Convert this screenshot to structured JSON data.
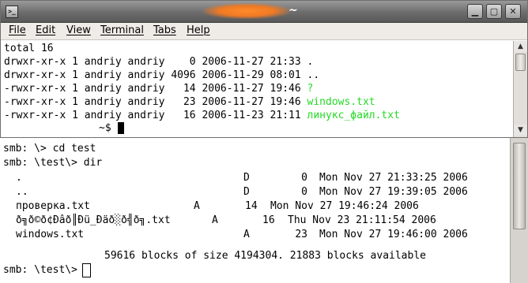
{
  "window": {
    "title": "~",
    "icon_glyph": ">_",
    "buttons": {
      "minimize": "▁",
      "maximize": "▢",
      "close": "✕"
    }
  },
  "menu": [
    "File",
    "Edit",
    "View",
    "Terminal",
    "Tabs",
    "Help"
  ],
  "listing": {
    "total": "total 16",
    "rows": [
      {
        "meta": "drwxr-xr-x 1 andriy andriy    0 2006-11-27 21:33 ",
        "name": "."
      },
      {
        "meta": "drwxr-xr-x 1 andriy andriy 4096 2006-11-29 08:01 ",
        "name": ".."
      },
      {
        "meta": "-rwxr-xr-x 1 andriy andriy   14 2006-11-27 19:46 ",
        "name": "?"
      },
      {
        "meta": "-rwxr-xr-x 1 andriy andriy   23 2006-11-27 19:46 ",
        "name": "windows.txt"
      },
      {
        "meta": "-rwxr-xr-x 1 andriy andriy   16 2006-11-23 21:11 ",
        "name": "линукс_файл.txt"
      }
    ],
    "prompt": "~$ "
  },
  "smb": {
    "cmd1": "smb: \\> cd test",
    "cmd2": "smb: \\test\\> dir",
    "entries": [
      {
        "name": ".",
        "attr": "D",
        "size": "0",
        "date": "Mon Nov 27 21:33:25 2006"
      },
      {
        "name": "..",
        "attr": "D",
        "size": "0",
        "date": "Mon Nov 27 19:39:05 2006"
      },
      {
        "name": "проверка.txt",
        "attr": "A",
        "size": "14",
        "date": "Mon Nov 27 19:46:24 2006"
      },
      {
        "name": "ð╗ð©ð¢Ðâð║Ðü_Ðäð░ð╣ð╗.txt",
        "attr": "A",
        "size": "16",
        "date": "Thu Nov 23 21:11:54 2006"
      },
      {
        "name": "windows.txt",
        "attr": "A",
        "size": "23",
        "date": "Mon Nov 27 19:46:00 2006"
      }
    ],
    "summary": "59616 blocks of size 4194304. 21883 blocks available",
    "prompt": "smb: \\test\\> "
  },
  "colors": {
    "highlight": "#26d926",
    "titlebar": "#6c6c6c",
    "menubar": "#efebe7"
  }
}
